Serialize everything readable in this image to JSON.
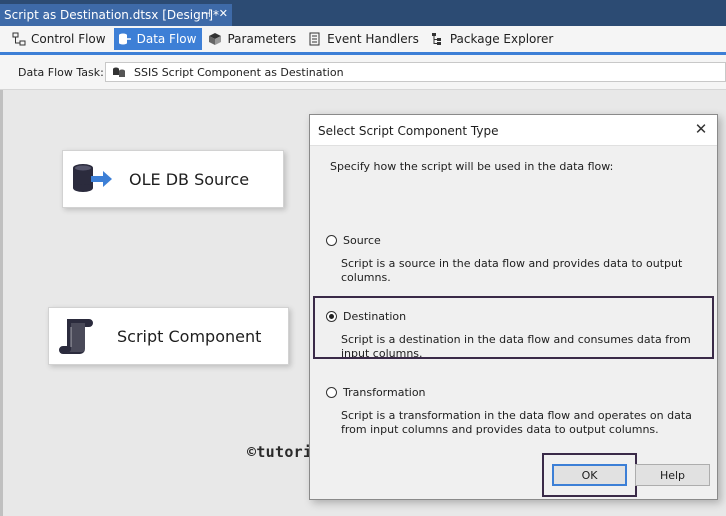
{
  "document_tab": {
    "title": "Script as Destination.dtsx [Design]*",
    "pin_glyph": "⊣",
    "close_glyph": "✕"
  },
  "designer_tabs": [
    {
      "label": "Control Flow",
      "icon": "control-flow-icon"
    },
    {
      "label": "Data Flow",
      "icon": "data-flow-icon",
      "active": true
    },
    {
      "label": "Parameters",
      "icon": "parameters-icon"
    },
    {
      "label": "Event Handlers",
      "icon": "event-handlers-icon"
    },
    {
      "label": "Package Explorer",
      "icon": "package-explorer-icon"
    }
  ],
  "task": {
    "label": "Data Flow Task:",
    "value": "SSIS Script Component as Destination"
  },
  "canvas": {
    "components": [
      {
        "label": "OLE DB Source",
        "icon": "ole-db-source-icon"
      },
      {
        "label": "Script Component",
        "icon": "script-component-icon"
      }
    ],
    "watermark": "©tutorialgateway.org"
  },
  "dialog": {
    "title": "Select Script Component Type",
    "prompt": "Specify how the script will be used in the data flow:",
    "options": [
      {
        "label": "Source",
        "description": "Script is a source in the data flow and provides data to output columns.",
        "checked": false
      },
      {
        "label": "Destination",
        "description": "Script is a destination in the data flow and consumes data from input columns.",
        "checked": true
      },
      {
        "label": "Transformation",
        "description": "Script is a transformation in the data flow and operates on data from input columns and provides data to output columns.",
        "checked": false
      }
    ],
    "ok_label": "OK",
    "help_label": "Help"
  },
  "colors": {
    "tab_blue": "#3d7fd6",
    "doc_tab": "#3e6aa8",
    "highlight_border": "#3a2a48"
  }
}
